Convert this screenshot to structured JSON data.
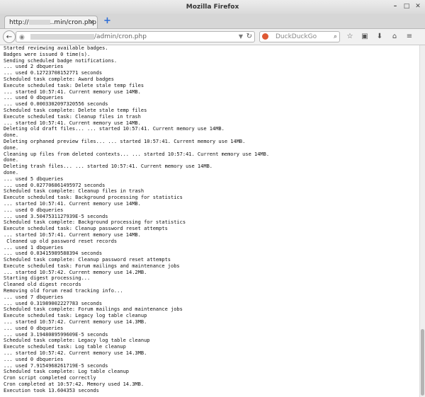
{
  "window": {
    "title": "Mozilla Firefox",
    "minimize": "–",
    "maximize": "□",
    "close": "✕"
  },
  "tab": {
    "label_prefix": "http://",
    "label_suffix": "..min/cron.php",
    "close": "✕"
  },
  "newtab": "+",
  "nav": {
    "back": "←",
    "url_suffix": "/admin/cron.php",
    "search_placeholder": "DuckDuckGo",
    "icons": [
      "star-icon",
      "clipboard-icon",
      "download-icon",
      "home-icon",
      "menu-icon"
    ]
  },
  "log_lines": [
    "Started reviewing available badges.",
    "Badges were issued 0 time(s).",
    "Sending scheduled badge notifications.",
    "... used 2 dbqueries",
    "... used 0.12723708152771 seconds",
    "Scheduled task complete: Award badges",
    "Execute scheduled task: Delete stale temp files",
    "... started 10:57:41. Current memory use 14MB.",
    "... used 0 dbqueries",
    "... used 0.0003302097320556 seconds",
    "Scheduled task complete: Delete stale temp files",
    "Execute scheduled task: Cleanup files in trash",
    "... started 10:57:41. Current memory use 14MB.",
    "Deleting old draft files... ... started 10:57:41. Current memory use 14MB.",
    "done.",
    "Deleting orphaned preview files... ... started 10:57:41. Current memory use 14MB.",
    "done.",
    "Cleaning up files from deleted contexts... ... started 10:57:41. Current memory use 14MB.",
    "done.",
    "Deleting trash files... ... started 10:57:41. Current memory use 14MB.",
    "done.",
    "... used 5 dbqueries",
    "... used 0.027706861495972 seconds",
    "Scheduled task complete: Cleanup files in trash",
    "Execute scheduled task: Background processing for statistics",
    "... started 10:57:41. Current memory use 14MB.",
    "... used 0 dbqueries",
    "... used 3.5047531127939E-5 seconds",
    "Scheduled task complete: Background processing for statistics",
    "Execute scheduled task: Cleanup password reset attempts",
    "... started 10:57:41. Current memory use 14MB.",
    " Cleaned up old password reset records",
    "... used 1 dbqueries",
    "... used 0.03415989588394 seconds",
    "Scheduled task complete: Cleanup password reset attempts",
    "Execute scheduled task: Forum mailings and maintenance jobs",
    "... started 10:57:42. Current memory use 14.2MB.",
    "Starting digest processing...",
    "Cleaned old digest records",
    "Removing old forum read tracking info...",
    "... used 7 dbqueries",
    "... used 0.31989002227783 seconds",
    "Scheduled task complete: Forum mailings and maintenance jobs",
    "Execute scheduled task: Legacy log table cleanup",
    "... started 10:57:42. Current memory use 14.3MB.",
    "... used 0 dbqueries",
    "... used 3.1948089599609E-5 seconds",
    "Scheduled task complete: Legacy log table cleanup",
    "Execute scheduled task: Log table cleanup",
    "... started 10:57:42. Current memory use 14.3MB.",
    "... used 0 dbqueries",
    "... used 7.9154968261719E-5 seconds",
    "Scheduled task complete: Log table cleanup",
    "Cron script completed correctly",
    "Cron completed at 10:57:42. Memory used 14.3MB.",
    "Execution took 13.604353 seconds"
  ]
}
